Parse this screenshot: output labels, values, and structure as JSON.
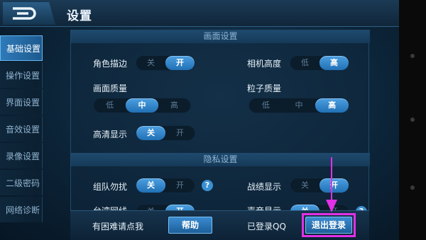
{
  "header": {
    "title": "设置"
  },
  "sidebar": {
    "items": [
      {
        "label": "基础设置",
        "active": true
      },
      {
        "label": "操作设置",
        "active": false
      },
      {
        "label": "界面设置",
        "active": false
      },
      {
        "label": "音效设置",
        "active": false
      },
      {
        "label": "录像设置",
        "active": false
      },
      {
        "label": "二级密码",
        "active": false
      },
      {
        "label": "网络诊断",
        "active": false
      }
    ]
  },
  "sections": {
    "graphics": "画面设置",
    "privacy": "隐私设置"
  },
  "settings": {
    "outline": {
      "label": "角色描边",
      "options": [
        "关",
        "开"
      ],
      "selected": "开"
    },
    "camera_height": {
      "label": "相机高度",
      "options": [
        "低",
        "高"
      ],
      "selected": "高"
    },
    "graphics_quality": {
      "label": "画面质量",
      "options": [
        "低",
        "中",
        "高"
      ],
      "selected": "中"
    },
    "particle_quality": {
      "label": "粒子质量",
      "options": [
        "低",
        "中",
        "高"
      ],
      "selected": "高"
    },
    "hd_display": {
      "label": "高清显示",
      "options": [
        "关",
        "开"
      ],
      "selected": "关"
    },
    "team_dnd": {
      "label": "组队勿扰",
      "options": [
        "关",
        "开"
      ],
      "selected": "关"
    },
    "record_display": {
      "label": "战绩显示",
      "options": [
        "关",
        "开"
      ],
      "selected": "开"
    },
    "row3_left": {
      "label": "台湾网线",
      "options": [
        "关",
        "开"
      ],
      "selected": "开"
    },
    "row3_right": {
      "label": "声音显示",
      "options": [
        "关",
        "开"
      ],
      "selected": "关"
    }
  },
  "help_icon": "?",
  "bottom": {
    "help_text": "有困难请点我",
    "help_button": "帮助",
    "login_status": "已登录QQ",
    "logout_button": "退出登录"
  },
  "colors": {
    "accent": "#2f7ab9",
    "highlight": "#e130e6"
  },
  "icons": {
    "back": "back-arrow-icon",
    "help": "question-icon",
    "pointer": "pointer-arrow-icon"
  }
}
